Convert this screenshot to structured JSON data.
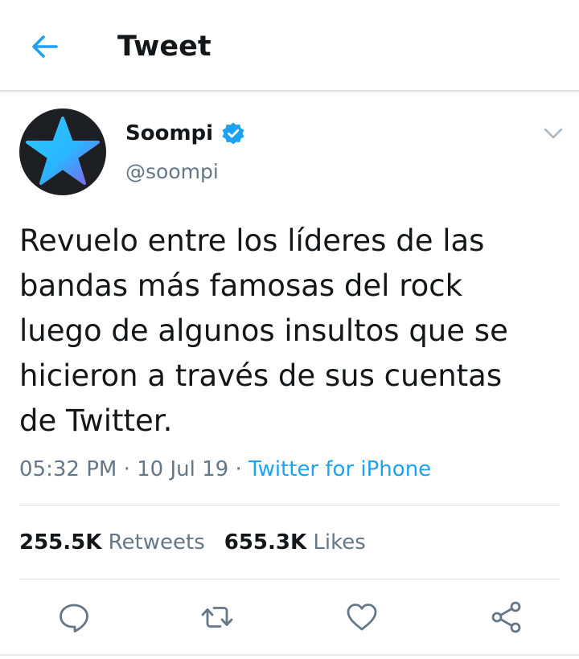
{
  "header": {
    "title": "Tweet",
    "back_icon": "arrow-left-icon"
  },
  "user": {
    "display_name": "Soompi",
    "handle": "@soompi",
    "verified_icon": "verified-badge-icon",
    "avatar_icon": "star-icon"
  },
  "tweet": {
    "text": "Revuelo entre los líderes de las\nbandas más famosas del rock\nluego de algunos insultos que se\nhicieron a través de sus cuentas\nde Twitter.",
    "time": "05:32 PM",
    "sep1": " · ",
    "date": "10 Jul 19",
    "sep2": " · ",
    "source": "Twitter for iPhone"
  },
  "stats": {
    "retweets_count": "255.5K",
    "retweets_label": "Retweets",
    "likes_count": "655.3K",
    "likes_label": "Likes"
  },
  "actions": [
    "reply-icon",
    "retweet-icon",
    "like-icon",
    "share-icon"
  ],
  "colors": {
    "accent": "#1da1f2",
    "secondary_text": "#657786",
    "divider": "#dfe3e6"
  }
}
